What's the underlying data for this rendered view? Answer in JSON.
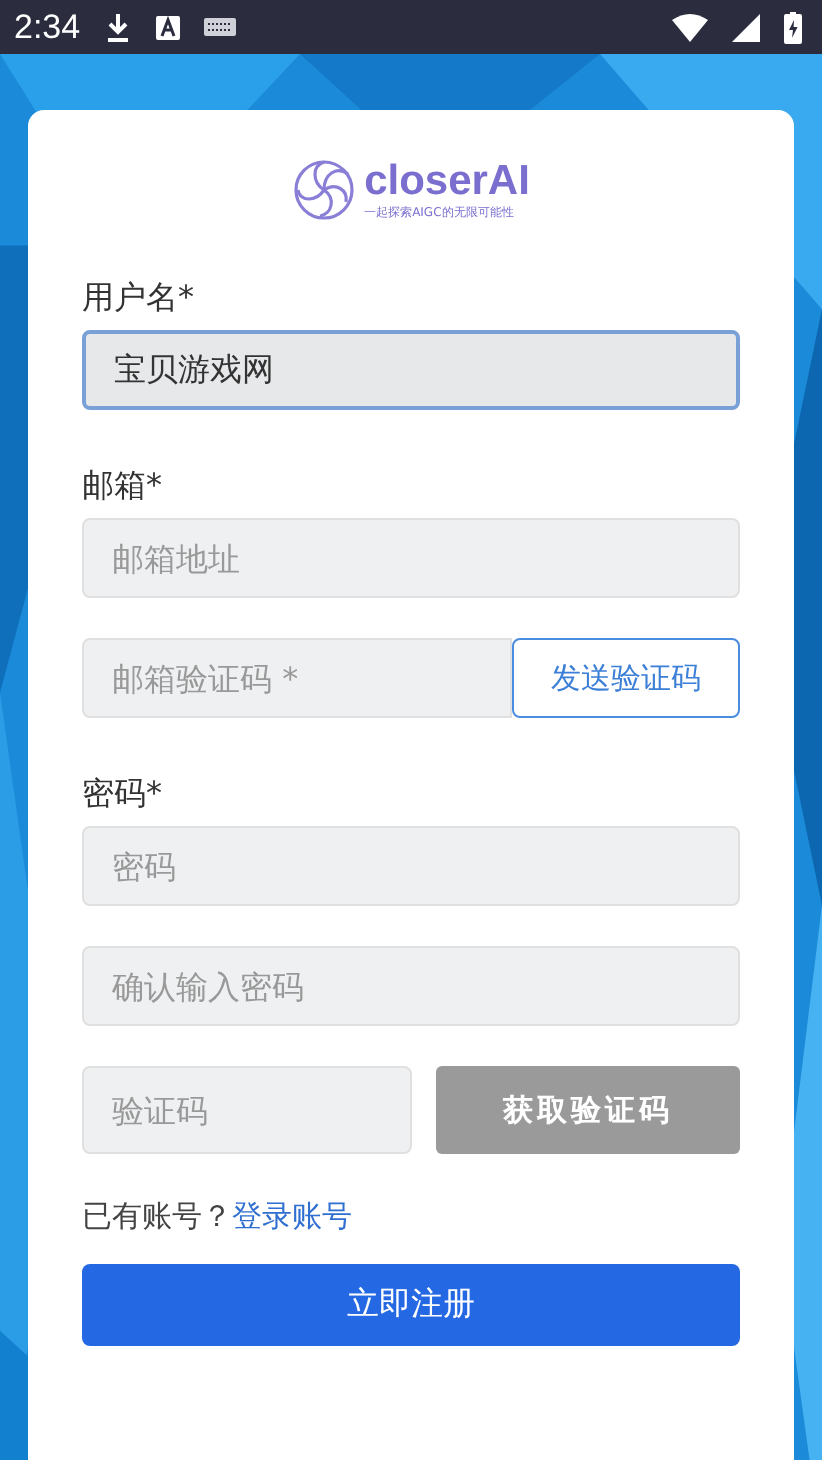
{
  "status_bar": {
    "time": "2:34"
  },
  "logo": {
    "name": "closerAI",
    "tagline": "一起探索AIGC的无限可能性"
  },
  "form": [
    {
      "kind": "label",
      "text": "用户名*"
    },
    {
      "kind": "input",
      "value": "宝贝游戏网",
      "focused": true
    },
    {
      "kind": "label",
      "text": "邮箱*"
    },
    {
      "kind": "input",
      "placeholder": "邮箱地址",
      "focused": false
    },
    {
      "kind": "input_button",
      "placeholder": "邮箱验证码 *",
      "button": "发送验证码",
      "disabled": false
    },
    {
      "kind": "label",
      "text": "密码*"
    },
    {
      "kind": "input",
      "placeholder": "密码",
      "focused": false
    },
    {
      "kind": "input",
      "placeholder": "确认输入密码",
      "focused": false
    },
    {
      "kind": "captcha",
      "placeholder": "验证码",
      "button": "获取验证码",
      "disabled": true
    }
  ],
  "login_prompt": {
    "text": "已有账号？",
    "link": "登录账号"
  },
  "submit": "立即注册"
}
